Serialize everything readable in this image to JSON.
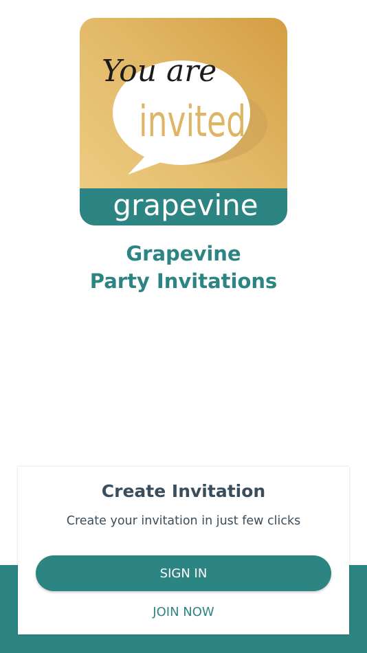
{
  "logo": {
    "line1": "You are",
    "line2": "invited",
    "brand": "grapevine"
  },
  "app": {
    "title_line1": "Grapevine",
    "title_line2": "Party Invitations"
  },
  "card": {
    "title": "Create Invitation",
    "subtitle": "Create your invitation in just few clicks",
    "signin_label": "SIGN IN",
    "join_label": "JOIN NOW"
  },
  "colors": {
    "primary_teal": "#2c8582",
    "gold": "#deb465",
    "text_dark": "#3a4d5c"
  }
}
